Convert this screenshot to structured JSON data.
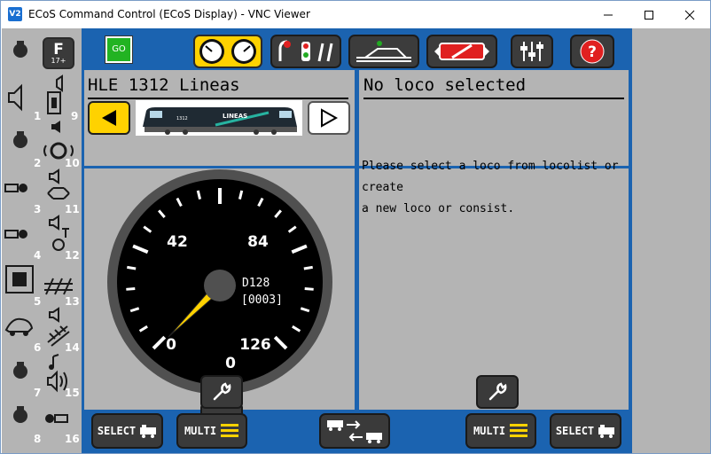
{
  "window": {
    "title": "ECoS Command Control (ECoS Display) - VNC Viewer",
    "app_icon_label": "V2"
  },
  "toolbar": {
    "go_label": "GO"
  },
  "function_panel": {
    "f_button_label": "F",
    "f_button_sub": "17+",
    "numbers": [
      "1",
      "9",
      "2",
      "10",
      "3",
      "11",
      "4",
      "12",
      "5",
      "13",
      "6",
      "14",
      "7",
      "15",
      "8",
      "16"
    ]
  },
  "left_cab": {
    "loco_name": "HLE 1312 Lineas",
    "loco_number": "1312",
    "loco_brand": "LINEAS",
    "speedometer": {
      "tick_labels": [
        "0",
        "42",
        "84",
        "126"
      ],
      "current_speed": "0",
      "speed_steps": "D128",
      "address": "[0003]",
      "needle_fraction": 0.0
    }
  },
  "right_cab": {
    "loco_name": "No loco selected",
    "message_line1": "Please select a loco from locolist or create",
    "message_line2": "a new loco or consist."
  },
  "bottom_bar": {
    "select_left": "SELECT",
    "multi_left": "MULTI",
    "multi_right": "MULTI",
    "select_right": "SELECT"
  },
  "colors": {
    "frame_blue": "#1b63b0",
    "panel_gray": "#b4b4b4",
    "button_dark": "#3a3a3a",
    "active_yellow": "#ffd200",
    "go_green": "#22b322"
  }
}
